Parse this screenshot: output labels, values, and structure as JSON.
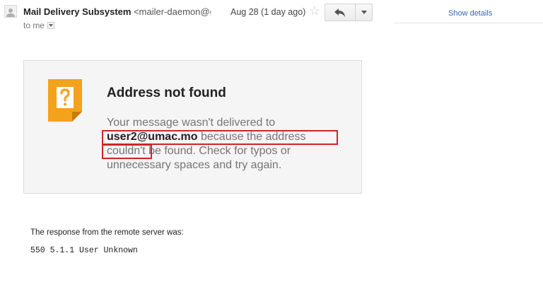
{
  "header": {
    "sender_name": "Mail Delivery Subsystem",
    "sender_email": "<mailer-daemon@gc",
    "recipient_line": "to me",
    "date": "Aug 28 (1 day ago)",
    "show_details": "Show details"
  },
  "icons": {
    "avatar": "person-icon",
    "star": "star-icon",
    "reply": "reply-arrow-icon",
    "more": "caret-down-icon",
    "warning": "question-note-icon"
  },
  "card": {
    "title": "Address not found",
    "message_before": "Your message wasn't delivered to ",
    "recipient": "user2@umac.mo",
    "message_middle": " because the address couldn't be found.",
    "message_after": " Check for typos or unnecessary spaces and try again."
  },
  "response": {
    "label": "The response from the remote server was:",
    "code": "550 5.1.1 User Unknown"
  },
  "colors": {
    "link": "#3367b8",
    "highlight_border": "#d0232a",
    "warning_icon": "#f4a21b",
    "card_bg": "#f5f5f5"
  }
}
